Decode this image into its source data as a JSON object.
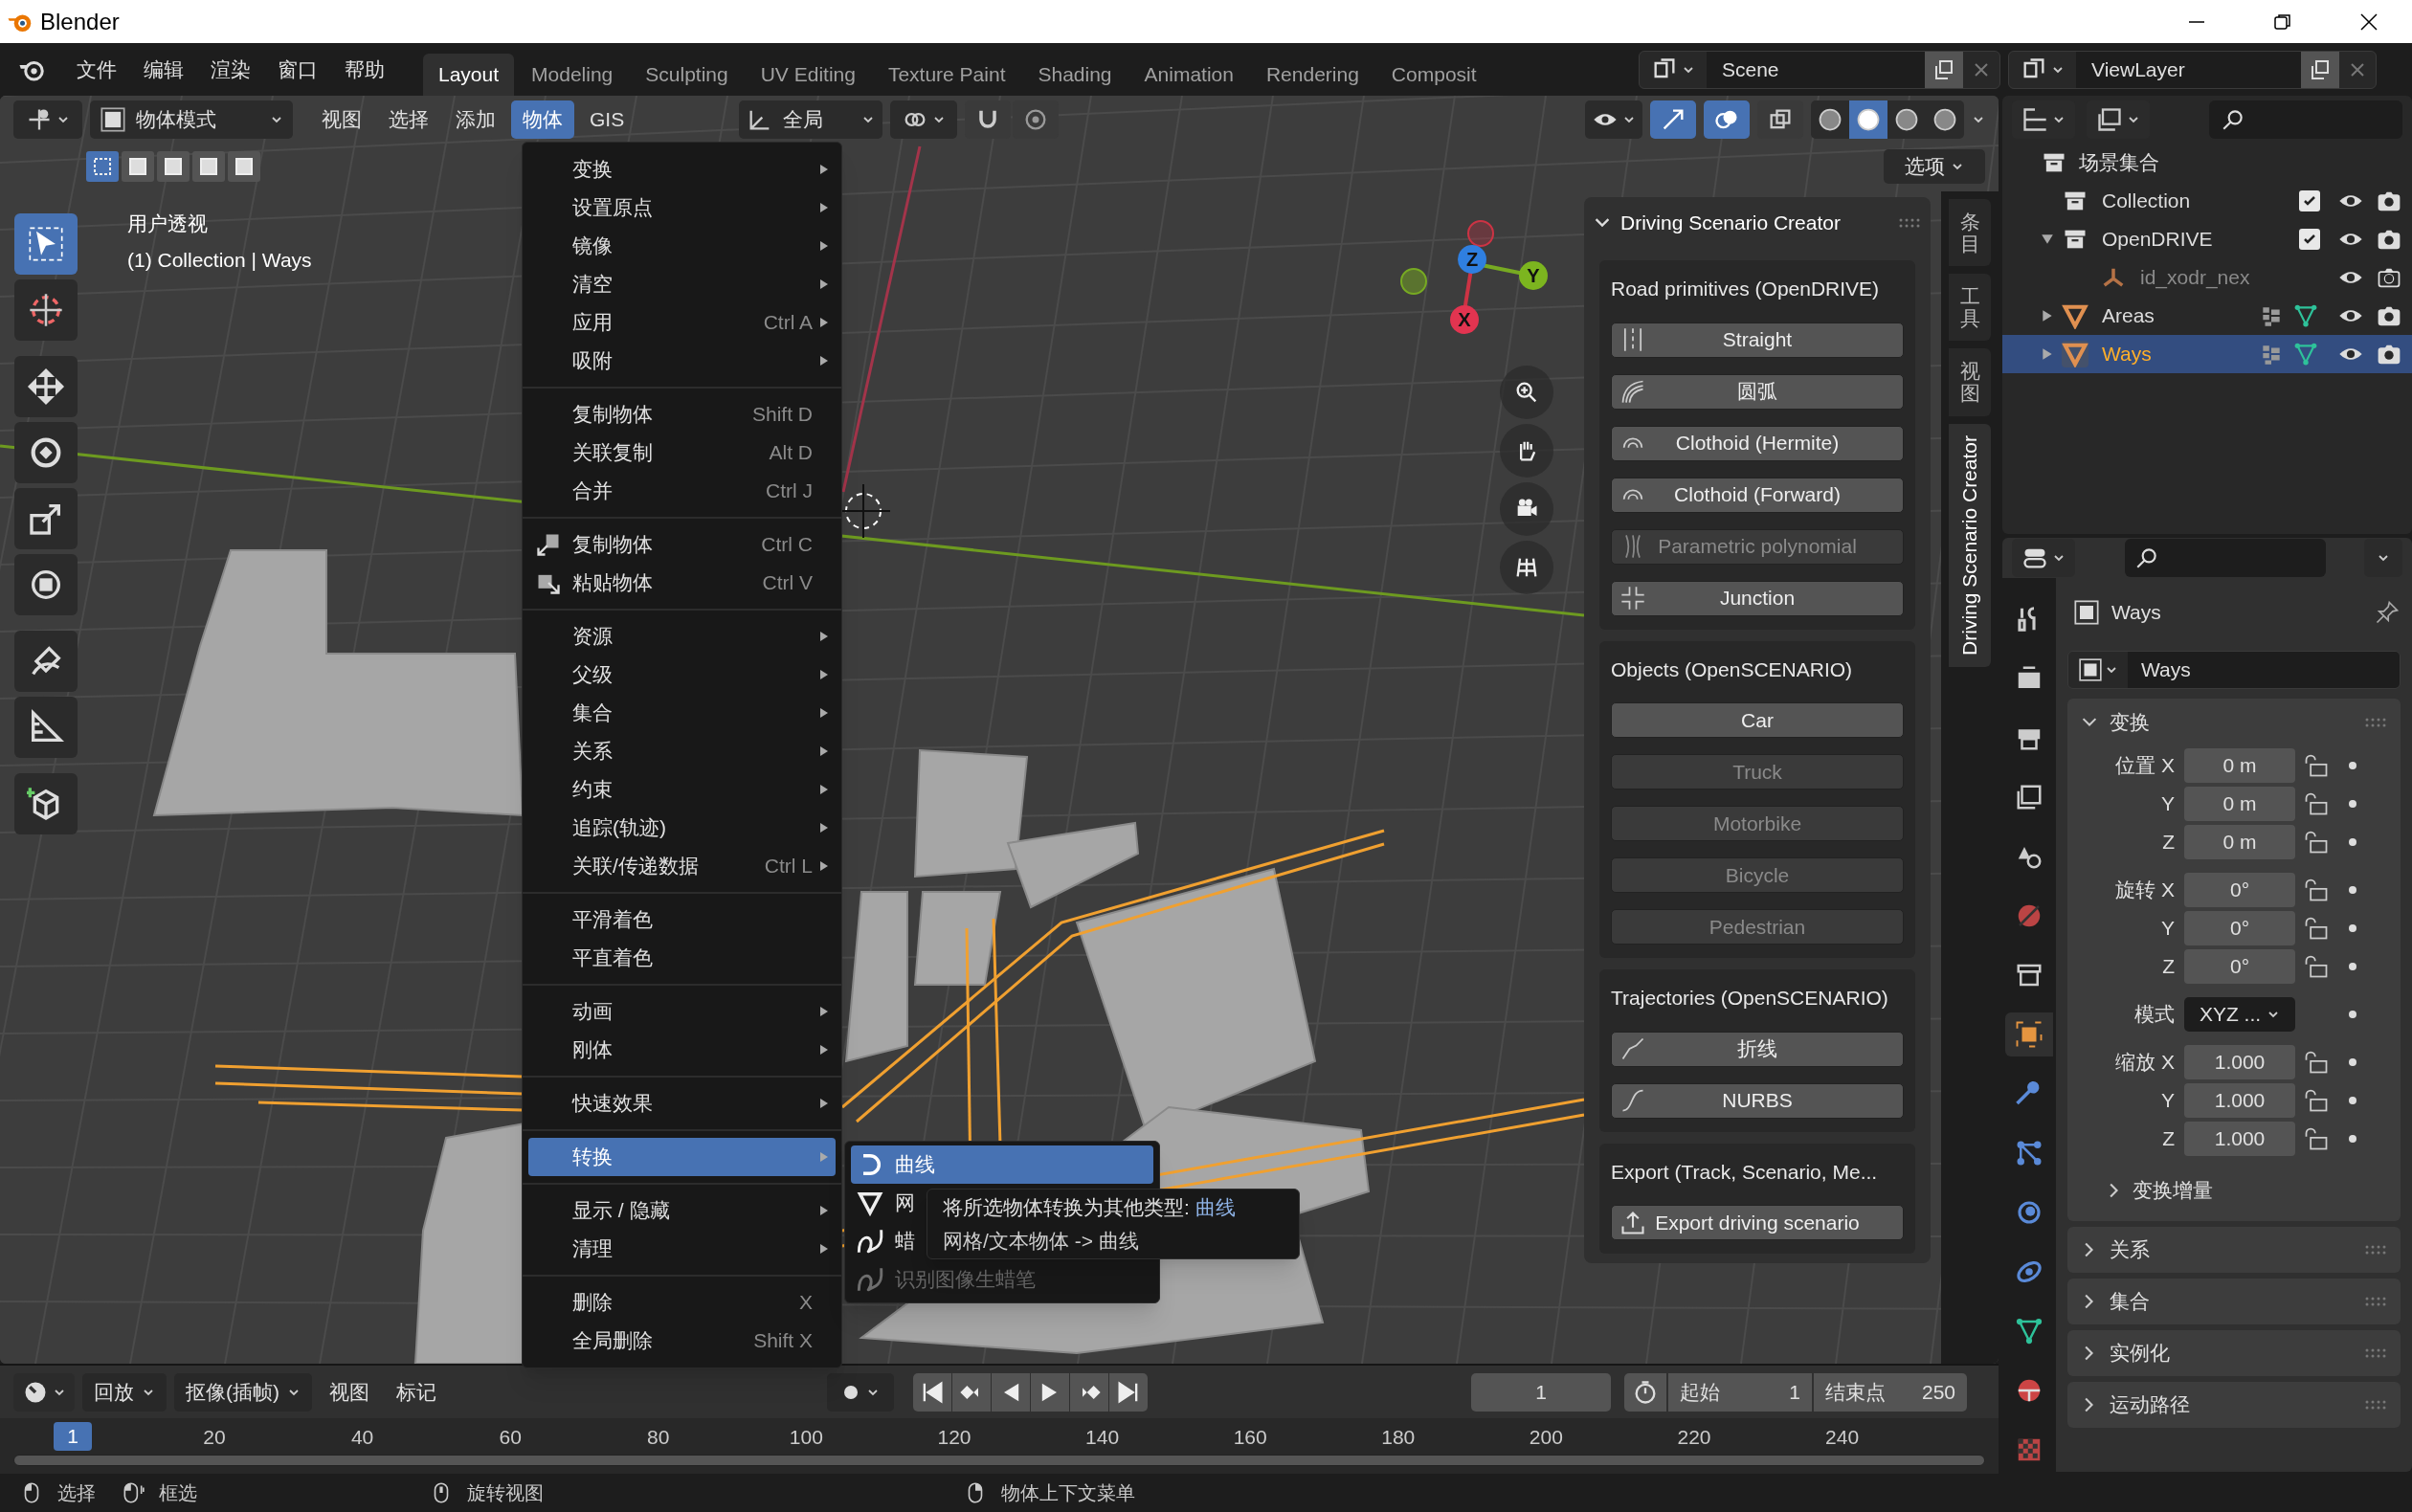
{
  "window": {
    "title": "Blender"
  },
  "menubar": [
    {
      "label": "文件"
    },
    {
      "label": "编辑"
    },
    {
      "label": "渲染"
    },
    {
      "label": "窗口"
    },
    {
      "label": "帮助"
    }
  ],
  "workspaces": [
    {
      "label": "Layout",
      "selected": true
    },
    {
      "label": "Modeling",
      "selected": false
    },
    {
      "label": "Sculpting",
      "selected": false
    },
    {
      "label": "UV Editing",
      "selected": false
    },
    {
      "label": "Texture Paint",
      "selected": false
    },
    {
      "label": "Shading",
      "selected": false
    },
    {
      "label": "Animation",
      "selected": false
    },
    {
      "label": "Rendering",
      "selected": false
    },
    {
      "label": "Composit",
      "selected": false
    }
  ],
  "scene": "Scene",
  "view_layer": "ViewLayer",
  "viewport": {
    "mode": "物体模式",
    "menus": [
      {
        "label": "视图",
        "selected": false
      },
      {
        "label": "选择",
        "selected": false
      },
      {
        "label": "添加",
        "selected": false
      },
      {
        "label": "物体",
        "selected": true
      },
      {
        "label": "GIS",
        "selected": false
      }
    ],
    "orientation": "全局",
    "left_toggles": [
      {
        "kind": "snap",
        "on": false
      },
      {
        "kind": "proportional",
        "on": false
      }
    ],
    "right_toggles": [
      {
        "kind": "gizmo",
        "on": true
      },
      {
        "kind": "overlay",
        "on": true
      },
      {
        "kind": "xray",
        "on": false
      }
    ],
    "shading": [
      {
        "selected": false
      },
      {
        "selected": true
      },
      {
        "selected": false
      },
      {
        "selected": false
      }
    ],
    "select_modes": [
      {
        "selected": true
      },
      {
        "selected": false
      },
      {
        "selected": false
      },
      {
        "selected": false
      },
      {
        "selected": false
      }
    ],
    "options": "选项",
    "view_name": "用户透视",
    "active_info": "(1) Collection | Ways",
    "gizmo": {
      "x": "X",
      "y": "Y",
      "z": "Z"
    },
    "tools": [
      {
        "kind": "select",
        "selected": true,
        "group_start": false
      },
      {
        "kind": "cursor",
        "selected": false,
        "group_start": false
      },
      {
        "kind": "move",
        "selected": false,
        "group_start": true
      },
      {
        "kind": "rotate",
        "selected": false,
        "group_start": false
      },
      {
        "kind": "scale",
        "selected": false,
        "group_start": false
      },
      {
        "kind": "transform",
        "selected": false,
        "group_start": false
      },
      {
        "kind": "annotate",
        "selected": false,
        "group_start": true
      },
      {
        "kind": "measure",
        "selected": false,
        "group_start": false
      },
      {
        "kind": "add_cube",
        "selected": false,
        "group_start": true
      }
    ]
  },
  "object_menu": {
    "sections": [
      [
        {
          "label": "变换",
          "submenu": true,
          "selected": false
        },
        {
          "label": "设置原点",
          "submenu": true,
          "selected": false
        },
        {
          "label": "镜像",
          "submenu": true,
          "selected": false
        },
        {
          "label": "清空",
          "submenu": true,
          "selected": false
        },
        {
          "label": "应用",
          "shortcut": "Ctrl A",
          "submenu": true,
          "selected": false
        },
        {
          "label": "吸附",
          "submenu": true,
          "selected": false
        }
      ],
      [
        {
          "label": "复制物体",
          "shortcut": "Shift D",
          "submenu": false,
          "selected": false
        },
        {
          "label": "关联复制",
          "shortcut": "Alt D",
          "submenu": false,
          "selected": false
        },
        {
          "label": "合并",
          "shortcut": "Ctrl J",
          "submenu": false,
          "selected": false
        }
      ],
      [
        {
          "label": "复制物体",
          "shortcut": "Ctrl C",
          "kind": "copy",
          "submenu": false,
          "selected": false
        },
        {
          "label": "粘贴物体",
          "shortcut": "Ctrl V",
          "kind": "paste",
          "submenu": false,
          "selected": false
        }
      ],
      [
        {
          "label": "资源",
          "submenu": true,
          "selected": false
        },
        {
          "label": "父级",
          "submenu": true,
          "selected": false
        },
        {
          "label": "集合",
          "submenu": true,
          "selected": false
        },
        {
          "label": "关系",
          "submenu": true,
          "selected": false
        },
        {
          "label": "约束",
          "submenu": true,
          "selected": false
        },
        {
          "label": "追踪(轨迹)",
          "submenu": true,
          "selected": false
        },
        {
          "label": "关联/传递数据",
          "shortcut": "Ctrl L",
          "submenu": true,
          "selected": false
        }
      ],
      [
        {
          "label": "平滑着色",
          "submenu": false,
          "selected": false
        },
        {
          "label": "平直着色",
          "submenu": false,
          "selected": false
        }
      ],
      [
        {
          "label": "动画",
          "submenu": true,
          "selected": false
        },
        {
          "label": "刚体",
          "submenu": true,
          "selected": false
        }
      ],
      [
        {
          "label": "快速效果",
          "submenu": true,
          "selected": false
        }
      ],
      [
        {
          "label": "转换",
          "submenu": true,
          "selected": true
        }
      ],
      [
        {
          "label": "显示 / 隐藏",
          "submenu": true,
          "selected": false
        },
        {
          "label": "清理",
          "submenu": true,
          "selected": false
        }
      ],
      [
        {
          "label": "删除",
          "shortcut": "X",
          "submenu": false,
          "selected": false
        },
        {
          "label": "全局删除",
          "shortcut": "Shift X",
          "submenu": false,
          "selected": false
        }
      ]
    ]
  },
  "convert_menu": [
    {
      "label": "曲线",
      "kind": "curve",
      "selected": true,
      "disabled": false
    },
    {
      "label": "网",
      "kind": "mesh",
      "selected": false,
      "disabled": false
    },
    {
      "label": "蜡",
      "kind": "gpencil",
      "selected": false,
      "disabled": false
    },
    {
      "label": "识别图像生蜡笔",
      "kind": "gpencil",
      "selected": false,
      "disabled": true
    }
  ],
  "tooltip": {
    "description": "将所选物体转换为其他类型:",
    "value": "曲线",
    "detail": "网格/文本物体 -> 曲线"
  },
  "sidebar_tabs": [
    {
      "label": "条目",
      "selected": false
    },
    {
      "label": "工具",
      "selected": false
    },
    {
      "label": "视图",
      "selected": false
    },
    {
      "label": "Driving Scenario Creator",
      "selected": true
    }
  ],
  "addon_panel": {
    "title": "Driving Scenario Creator",
    "sections": [
      {
        "title": "Road primitives (OpenDRIVE)",
        "buttons": [
          {
            "label": "Straight",
            "kind": "straight",
            "disabled": false
          },
          {
            "label": "圆弧",
            "kind": "arc",
            "disabled": false
          },
          {
            "label": "Clothoid (Hermite)",
            "kind": "spiral",
            "disabled": false
          },
          {
            "label": "Clothoid (Forward)",
            "kind": "spiral",
            "disabled": false
          },
          {
            "label": "Parametric polynomial",
            "kind": "poly",
            "disabled": true
          },
          {
            "label": "Junction",
            "kind": "junction",
            "disabled": false
          }
        ]
      },
      {
        "title": "Objects (OpenSCENARIO)",
        "buttons": [
          {
            "label": "Car",
            "disabled": false
          },
          {
            "label": "Truck",
            "disabled": true
          },
          {
            "label": "Motorbike",
            "disabled": true
          },
          {
            "label": "Bicycle",
            "disabled": true
          },
          {
            "label": "Pedestrian",
            "disabled": true
          }
        ]
      },
      {
        "title": "Trajectories (OpenSCENARIO)",
        "buttons": [
          {
            "label": "折线",
            "kind": "polyline",
            "disabled": false
          },
          {
            "label": "NURBS",
            "kind": "nurbs",
            "disabled": false
          }
        ]
      },
      {
        "title": "Export (Track, Scenario, Me...",
        "buttons": [
          {
            "label": "Export driving scenario",
            "kind": "export",
            "disabled": false
          }
        ]
      }
    ]
  },
  "outliner": {
    "root": "场景集合",
    "items": [
      {
        "kind": "collection",
        "label": "Collection",
        "checked": true,
        "selected": false
      },
      {
        "kind": "collection",
        "label": "OpenDRIVE",
        "checked": true,
        "selected": false,
        "expanded": true,
        "children": [
          {
            "kind": "empty",
            "label": "id_xodr_nex",
            "selected": false
          }
        ]
      },
      {
        "kind": "object",
        "label": "Areas",
        "selected": false,
        "expanded": false
      },
      {
        "kind": "object",
        "label": "Ways",
        "selected": true,
        "expanded": false
      }
    ]
  },
  "properties": {
    "tabs": [
      {
        "kind": "tool",
        "selected": false
      },
      {
        "kind": "render",
        "selected": false
      },
      {
        "kind": "output",
        "selected": false
      },
      {
        "kind": "view_layer",
        "selected": false
      },
      {
        "kind": "scene",
        "selected": false
      },
      {
        "kind": "world",
        "selected": false
      },
      {
        "kind": "collection",
        "selected": false
      },
      {
        "kind": "object",
        "selected": true
      },
      {
        "kind": "modifier",
        "selected": false
      },
      {
        "kind": "particles",
        "selected": false
      },
      {
        "kind": "physics",
        "selected": false
      },
      {
        "kind": "constraints",
        "selected": false
      },
      {
        "kind": "data",
        "selected": false
      },
      {
        "kind": "material",
        "selected": false
      },
      {
        "kind": "texture",
        "selected": false
      }
    ],
    "object_name": "Ways",
    "data_name": "Ways",
    "transform": {
      "title": "变换",
      "expanded": true,
      "rows": [
        {
          "kind": "number",
          "label": "位置 X",
          "value": "0 m",
          "gap_before": false
        },
        {
          "kind": "number",
          "label": "Y",
          "value": "0 m",
          "gap_before": false
        },
        {
          "kind": "number",
          "label": "Z",
          "value": "0 m",
          "gap_before": false
        },
        {
          "kind": "number",
          "label": "旋转 X",
          "value": "0°",
          "gap_before": true
        },
        {
          "kind": "number",
          "label": "Y",
          "value": "0°",
          "gap_before": false
        },
        {
          "kind": "number",
          "label": "Z",
          "value": "0°",
          "gap_before": false
        },
        {
          "kind": "dropdown",
          "label": "模式",
          "value": "XYZ ...",
          "gap_before": true
        },
        {
          "kind": "number",
          "label": "缩放 X",
          "value": "1.000",
          "gap_before": true
        },
        {
          "kind": "number",
          "label": "Y",
          "value": "1.000",
          "gap_before": false
        },
        {
          "kind": "number",
          "label": "Z",
          "value": "1.000",
          "gap_before": false
        }
      ],
      "subpanel": {
        "title": "变换增量",
        "expanded": false
      }
    },
    "panels": [
      {
        "title": "关系",
        "expanded": false
      },
      {
        "title": "集合",
        "expanded": false
      },
      {
        "title": "实例化",
        "expanded": false
      },
      {
        "title": "运动路径",
        "expanded": false
      }
    ]
  },
  "timeline": {
    "menus": [
      {
        "label": "回放",
        "dropdown": true
      },
      {
        "label": "抠像(插帧)",
        "dropdown": true
      },
      {
        "label": "视图",
        "dropdown": false
      },
      {
        "label": "标记",
        "dropdown": false
      }
    ],
    "current_frame": "1",
    "start_label": "起始",
    "start": "1",
    "end_label": "结束点",
    "end": "250",
    "playhead": "1",
    "ticks": [
      "20",
      "40",
      "60",
      "80",
      "100",
      "120",
      "140",
      "160",
      "180",
      "200",
      "220",
      "240"
    ]
  },
  "status_bar": [
    {
      "label": "选择",
      "kind": "left"
    },
    {
      "label": "框选",
      "kind": "drag"
    },
    {
      "label": "旋转视图",
      "kind": "middle"
    },
    {
      "label": "物体上下文菜单",
      "kind": "right"
    }
  ]
}
